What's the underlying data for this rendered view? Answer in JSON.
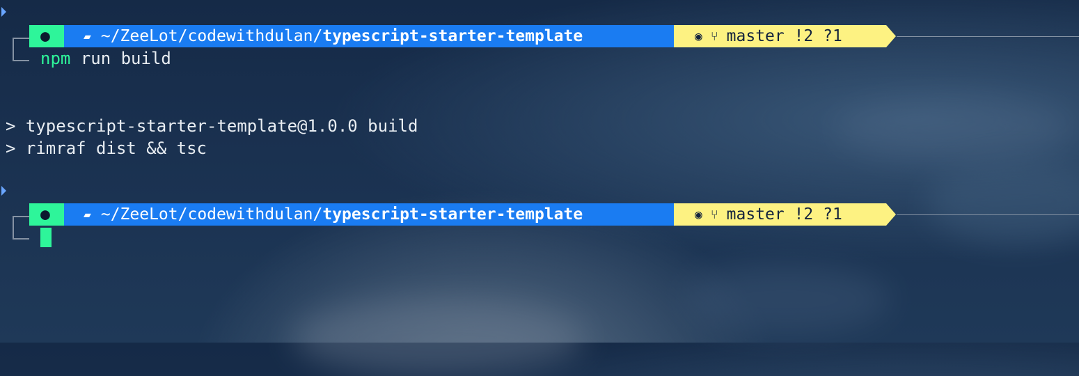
{
  "background": {
    "sky_top": "#152a47",
    "sky_bottom": "#1f3958",
    "cloud": "#4a6483"
  },
  "colors": {
    "os_segment": "#2ef59a",
    "path_segment": "#1a7cf2",
    "git_segment": "#fdf282",
    "command": "#2ef59a",
    "text": "#e8edf2",
    "marker": "#6aa6ff"
  },
  "prompt1": {
    "os_icon": "apple-icon",
    "folder_icon": "folder-icon",
    "path_prefix": "~/ZeeLot/codewithdulan/",
    "path_bold": "typescript-starter-template",
    "github_icon": "github-icon",
    "branch_icon": "git-branch-icon",
    "git_status": "master !2 ?1",
    "command_name": "npm",
    "command_args": " run build"
  },
  "output": {
    "line1": "> typescript-starter-template@1.0.0 build",
    "line2": "> rimraf dist && tsc"
  },
  "prompt2": {
    "os_icon": "apple-icon",
    "folder_icon": "folder-icon",
    "path_prefix": "~/ZeeLot/codewithdulan/",
    "path_bold": "typescript-starter-template",
    "github_icon": "github-icon",
    "branch_icon": "git-branch-icon",
    "git_status": "master !2 ?1"
  }
}
